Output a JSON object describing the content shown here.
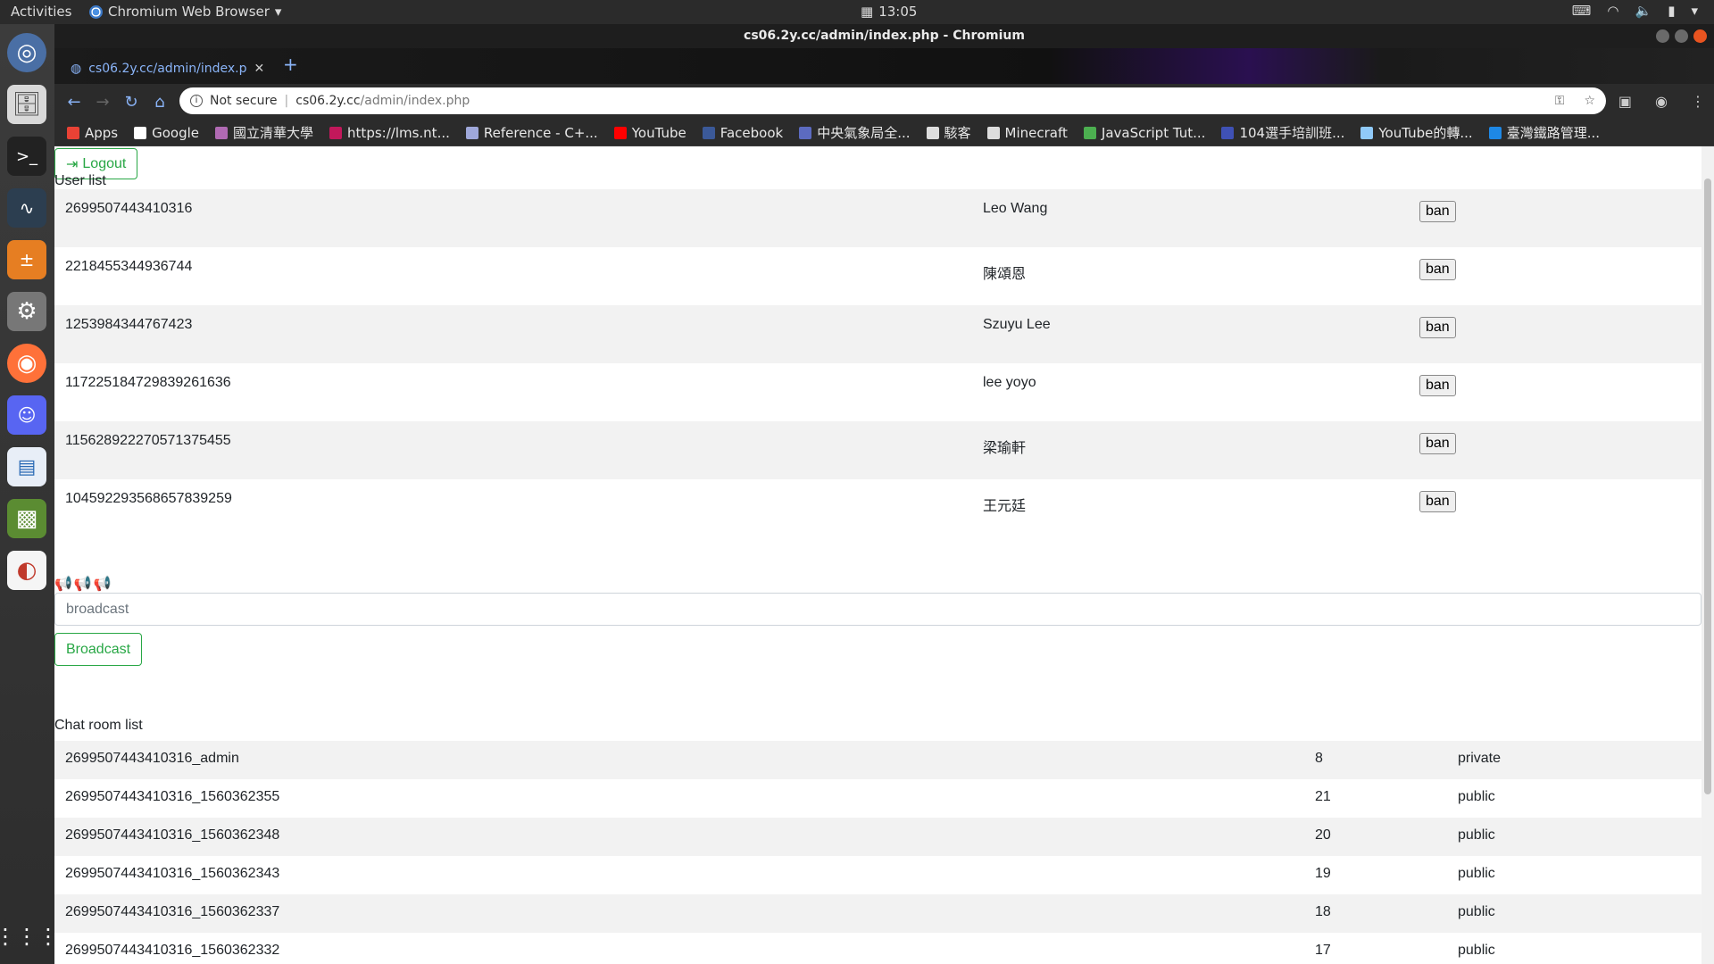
{
  "topbar": {
    "activities": "Activities",
    "app_name": "Chromium Web Browser",
    "clock": "13:05"
  },
  "dock": {
    "items": [
      "chromium-icon",
      "files-icon",
      "terminal-icon",
      "system-monitor-icon",
      "calculator-icon",
      "settings-icon",
      "firefox-icon",
      "discord-icon",
      "writer-icon",
      "minecraft-icon",
      "eclipse-icon",
      "app-grid-icon"
    ]
  },
  "window": {
    "title": "cs06.2y.cc/admin/index.php - Chromium"
  },
  "tab": {
    "label": "cs06.2y.cc/admin/index.p"
  },
  "omnibox": {
    "security": "Not secure",
    "host": "cs06.2y.cc",
    "path": "/admin/index.php"
  },
  "bookmarks": [
    {
      "label": "Apps",
      "color": "#e94235"
    },
    {
      "label": "Google",
      "color": "#ffffff"
    },
    {
      "label": "國立清華大學",
      "color": "#b06ab3"
    },
    {
      "label": "https://lms.nt...",
      "color": "#c2185b"
    },
    {
      "label": "Reference - C+...",
      "color": "#9fa8da"
    },
    {
      "label": "YouTube",
      "color": "#ff0000"
    },
    {
      "label": "Facebook",
      "color": "#3b5998"
    },
    {
      "label": "中央氣象局全...",
      "color": "#5c6bc0"
    },
    {
      "label": "駭客",
      "color": "#dddddd"
    },
    {
      "label": "Minecraft",
      "color": "#dddddd"
    },
    {
      "label": "JavaScript Tut...",
      "color": "#4caf50"
    },
    {
      "label": "104選手培訓班...",
      "color": "#3f51b5"
    },
    {
      "label": "YouTube的轉...",
      "color": "#90caf9"
    },
    {
      "label": "臺灣鐵路管理...",
      "color": "#1e88e5"
    }
  ],
  "page": {
    "logout_label": "Logout",
    "user_list_label": "User list",
    "users": [
      {
        "id": "2699507443410316",
        "name": "Leo Wang"
      },
      {
        "id": "2218455344936744",
        "name": "陳頌恩"
      },
      {
        "id": "1253984344767423",
        "name": "Szuyu Lee"
      },
      {
        "id": "117225184729839261636",
        "name": "lee yoyo"
      },
      {
        "id": "115628922270571375455",
        "name": "梁瑜軒"
      },
      {
        "id": "104592293568657839259",
        "name": "王元廷"
      }
    ],
    "ban_label": "ban",
    "megaphones": "📢📢📢",
    "broadcast_placeholder": "broadcast",
    "broadcast_label": "Broadcast",
    "chat_room_list_label": "Chat room list",
    "rooms": [
      {
        "name": "2699507443410316_admin",
        "count": "8",
        "type": "private"
      },
      {
        "name": "2699507443410316_1560362355",
        "count": "21",
        "type": "public"
      },
      {
        "name": "2699507443410316_1560362348",
        "count": "20",
        "type": "public"
      },
      {
        "name": "2699507443410316_1560362343",
        "count": "19",
        "type": "public"
      },
      {
        "name": "2699507443410316_1560362337",
        "count": "18",
        "type": "public"
      },
      {
        "name": "2699507443410316_1560362332",
        "count": "17",
        "type": "public"
      }
    ]
  },
  "colors": {
    "accent_green": "#28a745",
    "row_stripe": "#f2f2f2"
  }
}
